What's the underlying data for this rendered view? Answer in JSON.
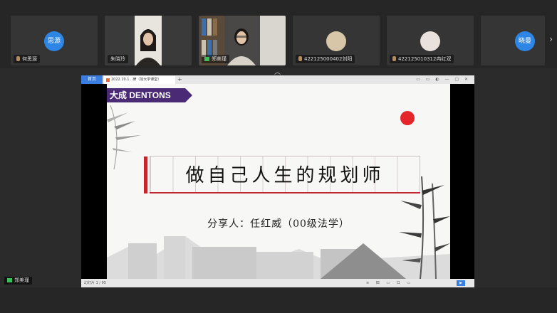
{
  "participants": [
    {
      "name": "何思源",
      "avatar_text": "思源",
      "type": "avatar",
      "audio": "mic"
    },
    {
      "name": "朱晓玲",
      "type": "video"
    },
    {
      "name": "郑美瑾",
      "type": "video-presenter",
      "audio": "camera"
    },
    {
      "name": "422125000402刘阳",
      "type": "photo",
      "audio": "mic"
    },
    {
      "name": "422125010312冉红双",
      "type": "photo",
      "audio": "mic"
    },
    {
      "name": "",
      "avatar_text": "晓曼",
      "type": "avatar"
    }
  ],
  "collapse_glyph": "︿",
  "next_glyph": "›",
  "share": {
    "tab_home": "首页",
    "tab_file": "2022.10.1...律（加大学课堂）",
    "tab_add": "+",
    "tab_tools": "▭ ▭ ◐ — ▢ ✕",
    "slide": {
      "logo": "大成 DENTONS",
      "title": "做自己人生的规划师",
      "sharer": "分享人：任红威（00级法学）"
    },
    "status": {
      "page": "幻灯片 1 / 95",
      "tools": "≡ 田 ▭ 口 ▭",
      "play": "▶"
    }
  },
  "self_label": "郑美瑾",
  "colors": {
    "background": "#2b2b2b",
    "accent_blue": "#2d86e6",
    "dentons_purple": "#4a2a74",
    "seal_red": "#e4262b"
  }
}
